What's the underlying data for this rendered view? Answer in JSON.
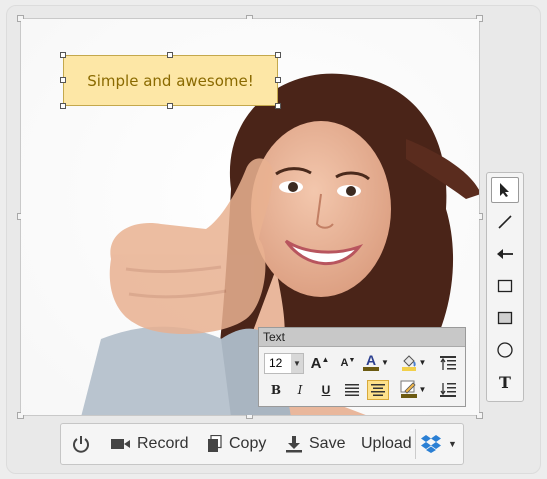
{
  "textbox": {
    "text": "Simple and awesome!"
  },
  "tools": [
    {
      "name": "select-tool",
      "icon": "cursor-icon",
      "active": true
    },
    {
      "name": "line-tool",
      "icon": "line-icon"
    },
    {
      "name": "arrow-tool",
      "icon": "arrow-icon"
    },
    {
      "name": "rectangle-tool",
      "icon": "rectangle-icon"
    },
    {
      "name": "filled-rectangle-tool",
      "icon": "filled-rectangle-icon"
    },
    {
      "name": "ellipse-tool",
      "icon": "ellipse-icon"
    },
    {
      "name": "text-tool",
      "icon": "text-icon",
      "glyph": "T"
    }
  ],
  "textpanel": {
    "title": "Text",
    "font_size": "12",
    "bold": "B",
    "italic": "I",
    "underline": "U",
    "grow_font": "A",
    "shrink_font": "A",
    "font_color": "A"
  },
  "toolbar": {
    "record_label": "Record",
    "copy_label": "Copy",
    "save_label": "Save",
    "upload_label": "Upload"
  },
  "colors": {
    "textbox_bg": "#fde7a6",
    "textbox_text": "#8a6a00",
    "active_button": "#fde18c",
    "dropbox_blue": "#2a7fd4"
  }
}
